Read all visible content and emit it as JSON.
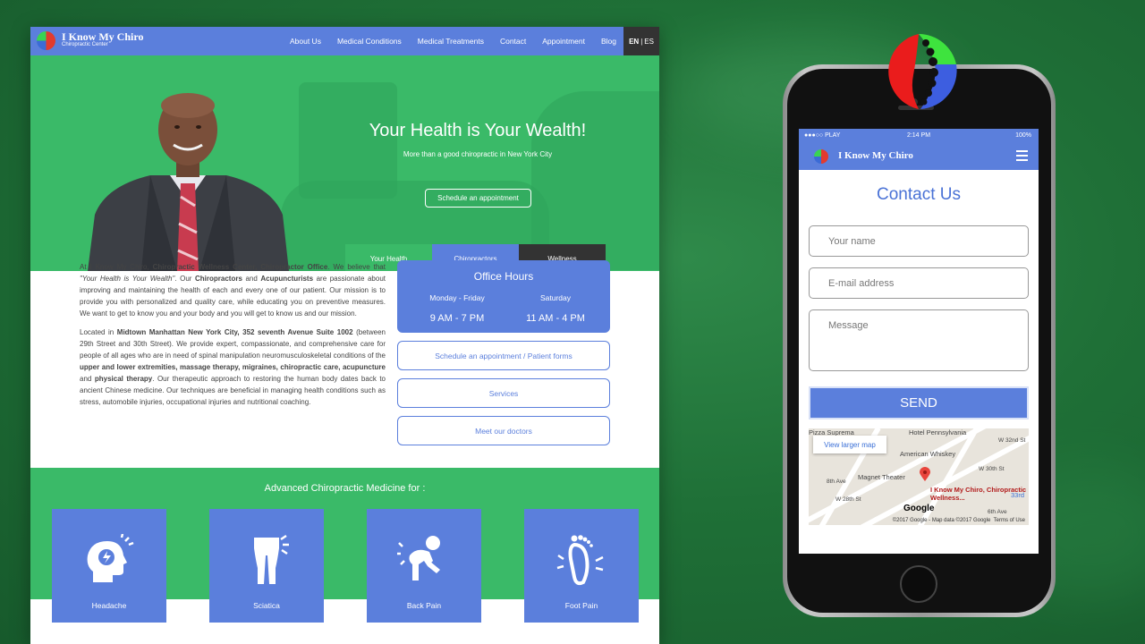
{
  "desktop": {
    "brand": "I Know My Chiro",
    "brand_sub": "Chiropractic Center",
    "nav": [
      "About Us",
      "Medical Conditions",
      "Medical Treatments",
      "Contact",
      "Appointment",
      "Blog"
    ],
    "lang": {
      "en": "EN",
      "sep": "|",
      "es": "ES"
    },
    "hero": {
      "title": "Your Health is Your Wealth!",
      "subtitle": "More than a good chiropractic in New York City",
      "cta": "Schedule an appointment"
    },
    "tabs": [
      "Your Health",
      "Chiropractors",
      "Wellness"
    ],
    "paragraph1": {
      "a": "At I Know My Chiro, ",
      "b": "Chiropractic Wellness Center, Chiropractor Office",
      "c": ". We believe that ",
      "d": "\"Your Health is Your Wealth\"",
      "e": ". Our ",
      "f": "Chiropractors",
      "g": " and ",
      "h": "Acupuncturists",
      "i": " are passionate about improving and maintaining the health of each and every one of our patient. Our mission is to provide you with personalized and quality care, while educating you on preventive measures. We want to get to know you and your body and you will get to know us and our mission."
    },
    "paragraph2": {
      "a": "Located in ",
      "b": "Midtown Manhattan New York City, 352 seventh Avenue Suite 1002",
      "c": " (between 29th Street and 30th Street). We provide expert, compassionate, and comprehensive care for people of all ages who are in need of spinal manipulation neuromusculoskeletal conditions of the ",
      "d": "upper and lower extremities, massage therapy, migraines, chiropractic care, acupuncture",
      "e": " and ",
      "f": "physical therapy",
      "g": ". Our therapeutic approach to restoring the human body dates back to ancient Chinese medicine. Our techniques are beneficial in managing health conditions such as stress, automobile injuries, occupational injuries and nutritional coaching."
    },
    "office_hours": {
      "title": "Office Hours",
      "weekday_label": "Monday - Friday",
      "weekday_hours": "9 AM - 7 PM",
      "saturday_label": "Saturday",
      "saturday_hours": "11 AM - 4 PM"
    },
    "buttons": [
      "Schedule an appointment / Patient forms",
      "Services",
      "Meet our doctors"
    ],
    "advanced_title": "Advanced Chiropractic Medicine for :",
    "conditions": [
      "Headache",
      "Sciatica",
      "Back Pain",
      "Foot Pain"
    ]
  },
  "mobile": {
    "status": {
      "carrier": "●●●○○ PLAY",
      "time": "2:14 PM",
      "battery": "100%"
    },
    "brand": "I Know My Chiro",
    "contact_title": "Contact Us",
    "fields": {
      "name": "Your name",
      "email": "E-mail address",
      "message": "Message"
    },
    "send": "SEND",
    "map": {
      "view_larger": "View larger map",
      "labels": [
        "Pizza Suprema",
        "Hotel Pennsylvania",
        "American Whiskey",
        "Magnet Theater",
        "W 32nd St",
        "W 30th St",
        "W 28th St",
        "8th Ave",
        "6th Ave",
        "33rd"
      ],
      "place": "I Know My Chiro, Chiropractic Wellness...",
      "google": "Google",
      "copyright": "©2017 Google - Map data ©2017 Google",
      "terms": "Terms of Use"
    }
  },
  "colors": {
    "green": "#3aba68",
    "blue": "#5b7fdc",
    "dark": "#333333"
  }
}
